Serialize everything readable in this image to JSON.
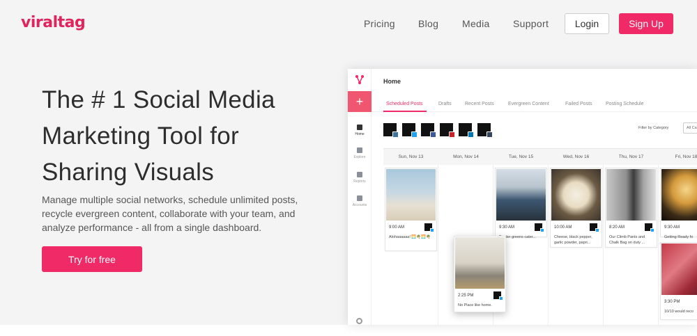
{
  "brand": {
    "logo": "viraltag",
    "accent": "#f02a66"
  },
  "nav": {
    "links": [
      "Pricing",
      "Blog",
      "Media",
      "Support"
    ],
    "login_label": "Login",
    "signup_label": "Sign Up"
  },
  "hero": {
    "title_lines": [
      "The # 1 Social Media",
      "Marketing Tool for",
      "Sharing Visuals"
    ],
    "description": "Manage multiple social networks, schedule unlimited posts, recycle evergreen content, collaborate with your team, and analyze performance - all from a single dashboard.",
    "cta_label": "Try for free"
  },
  "app": {
    "plus_label": "+",
    "sidebar": [
      "Home",
      "Explore",
      "Reports",
      "Accounts"
    ],
    "title": "Home",
    "tabs": [
      "Scheduled Posts",
      "Drafts",
      "Recent Posts",
      "Evergreen Content",
      "Failed Posts",
      "Posting Schedule"
    ],
    "accounts": [
      {
        "icon": "instagram-icon",
        "color": "#3f729b"
      },
      {
        "icon": "twitter-icon",
        "color": "#1da1f2"
      },
      {
        "icon": "facebook-icon",
        "color": "#3b5998"
      },
      {
        "icon": "pinterest-icon",
        "color": "#cb2027"
      },
      {
        "icon": "linkedin-icon",
        "color": "#0077b5"
      },
      {
        "icon": "tumblr-icon",
        "color": "#35465c"
      }
    ],
    "filter_label": "Filter by Category",
    "filter_value": "All Ca",
    "days": [
      "Sun, Nov 13",
      "Mon, Nov 14",
      "Tue, Nov 15",
      "Wed, Nov 16",
      "Thu, Nov 17",
      "Fri, Nov 18"
    ],
    "posts": [
      {
        "time": "9:00 AM",
        "caption": "Alohaaaaaa! 🌅🌴🌅🌴"
      },
      {
        "time": "9:30 AM",
        "caption": "Border greens cater..."
      },
      {
        "time": "10:00 AM",
        "caption": "Cheese, black pepper, garlic powder, papri..."
      },
      {
        "time": "8:20 AM",
        "caption": "Our Climb Pants and Chalk Bag on duty ..."
      },
      {
        "time": "9:30 AM",
        "caption": "Getting Ready fo"
      },
      {
        "time": "3:30 PM",
        "caption": "10/10 would reco"
      }
    ],
    "dragged_post": {
      "time": "2:25 PM",
      "caption": "No Place like home."
    }
  }
}
